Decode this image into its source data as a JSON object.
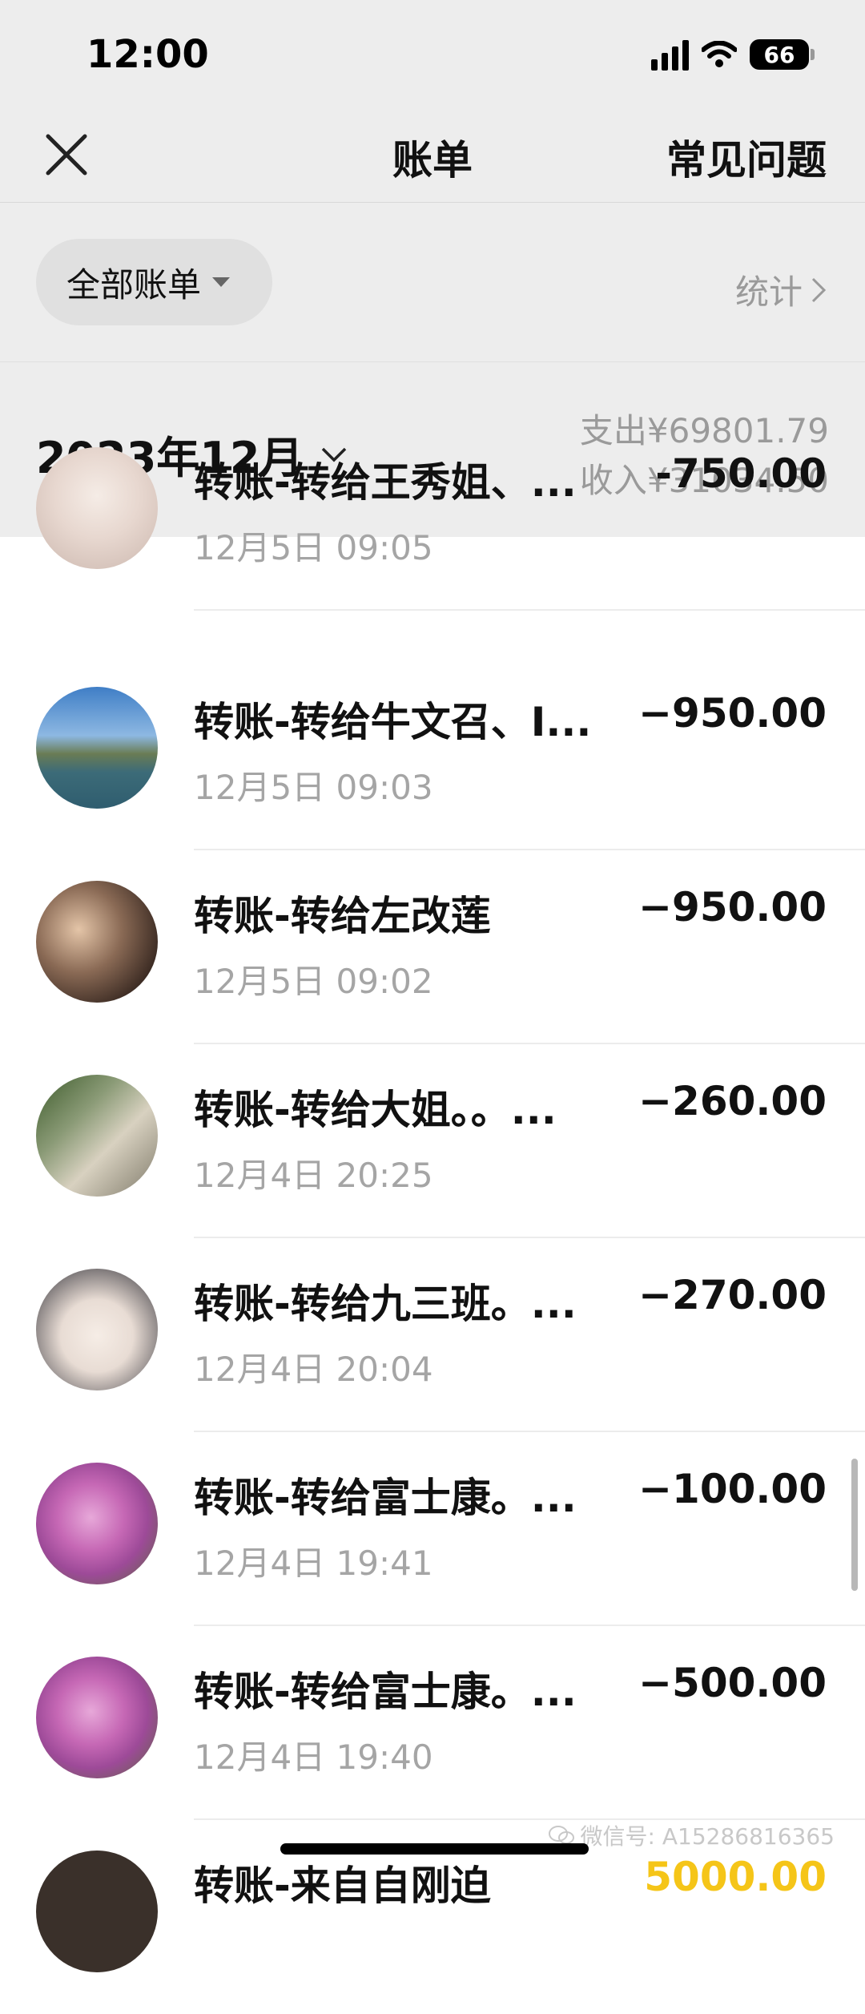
{
  "status_bar": {
    "time": "12:00",
    "battery": "66"
  },
  "nav": {
    "title": "账单",
    "faq": "常见问题"
  },
  "filter": {
    "label": "全部账单",
    "stats": "统计"
  },
  "month": {
    "label": "2023年12月",
    "expense": "支出¥69801.79",
    "income": "收入¥31034.50"
  },
  "transactions": [
    {
      "title": "转账-转给王秀姐、...",
      "time": "12月5日 09:05",
      "amount": "-750.00",
      "avatar": "girl-illustration"
    },
    {
      "title": "转账-转给牛文召、I...",
      "time": "12月5日 09:03",
      "amount": "−950.00",
      "avatar": "coast-photo"
    },
    {
      "title": "转账-转给左改莲",
      "time": "12月5日 09:02",
      "amount": "−950.00",
      "avatar": "woman-portrait"
    },
    {
      "title": "转账-转给大姐。。...",
      "time": "12月4日 20:25",
      "amount": "−260.00",
      "avatar": "garden-photo"
    },
    {
      "title": "转账-转给九三班。...",
      "time": "12月4日 20:04",
      "amount": "−270.00",
      "avatar": "baby-photo"
    },
    {
      "title": "转账-转给富士康。...",
      "time": "12月4日 19:41",
      "amount": "−100.00",
      "avatar": "flower-photo"
    },
    {
      "title": "转账-转给富士康。...",
      "time": "12月4日 19:40",
      "amount": "−500.00",
      "avatar": "flower-photo"
    },
    {
      "title": "转账-来自自刚迫",
      "time": "",
      "amount": "5000.00",
      "avatar": "dark-photo"
    }
  ],
  "watermark": "微信号: A15286816365",
  "colors": {
    "header_bg": "#ededed",
    "muted_text": "#a5a5a5",
    "income_amount": "#f5c518"
  }
}
